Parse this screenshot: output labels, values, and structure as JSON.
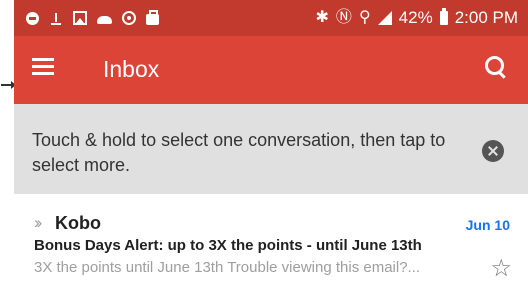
{
  "status_bar": {
    "left_icons": [
      "notification-icon",
      "upload-icon",
      "image-icon",
      "cloud-icon",
      "location-icon",
      "bag-icon"
    ],
    "right_glyphs": {
      "bluetooth": "✱",
      "nfc": "Ⓝ",
      "wifi": "⚲"
    },
    "battery": "42%",
    "time": "2:00 PM"
  },
  "toolbar": {
    "title": "Inbox",
    "accent": "#db4437",
    "status_color": "#c23a2d"
  },
  "tip": {
    "text": "Touch & hold to select one conversation, then tap to select more."
  },
  "emails": [
    {
      "importance_marker": "››",
      "sender": "Kobo",
      "date": "Jun 10",
      "subject": "Bonus Days Alert: up to 3X the points - until June 13th",
      "snippet": "3X the points until June 13th Trouble viewing this email?...",
      "star": "☆"
    }
  ]
}
